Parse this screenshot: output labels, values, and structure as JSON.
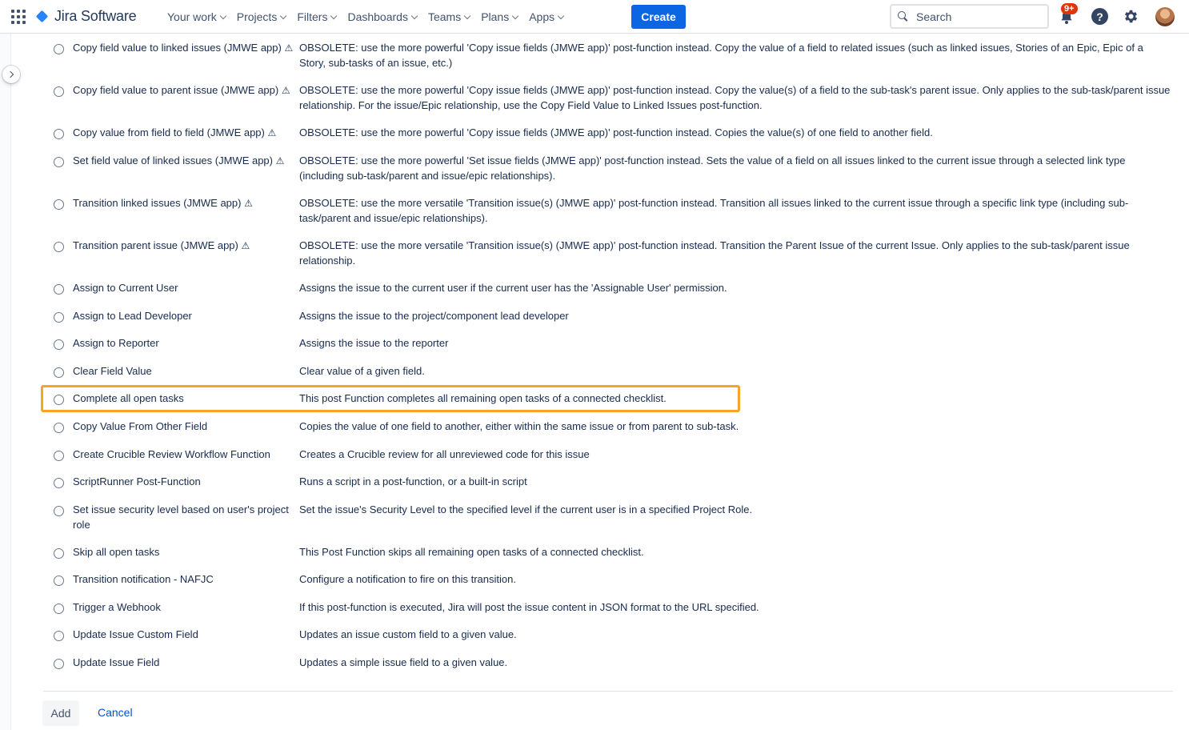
{
  "header": {
    "app_name": "Jira Software",
    "nav": [
      "Your work",
      "Projects",
      "Filters",
      "Dashboards",
      "Teams",
      "Plans",
      "Apps"
    ],
    "create_label": "Create",
    "search_placeholder": "Search",
    "notification_count": "9+",
    "help_label": "?"
  },
  "functions": [
    {
      "name": "Copy field value to linked issues (JMWE app)",
      "warning": true,
      "description": "OBSOLETE: use the more powerful 'Copy issue fields (JMWE app)' post-function instead. Copy the value of a field to related issues (such as linked issues, Stories of an Epic, Epic of a Story, sub-tasks of an issue, etc.)"
    },
    {
      "name": "Copy field value to parent issue (JMWE app)",
      "warning": true,
      "description": "OBSOLETE: use the more powerful 'Copy issue fields (JMWE app)' post-function instead. Copy the value(s) of a field to the sub-task's parent issue. Only applies to the sub-task/parent issue relationship. For the issue/Epic relationship, use the Copy Field Value to Linked Issues post-function."
    },
    {
      "name": "Copy value from field to field (JMWE app)",
      "warning": true,
      "description": "OBSOLETE: use the more powerful 'Copy issue fields (JMWE app)' post-function instead. Copies the value(s) of one field to another field."
    },
    {
      "name": "Set field value of linked issues (JMWE app)",
      "warning": true,
      "description": "OBSOLETE: use the more powerful 'Set issue fields (JMWE app)' post-function instead. Sets the value of a field on all issues linked to the current issue through a selected link type (including sub-task/parent and issue/epic relationships)."
    },
    {
      "name": "Transition linked issues (JMWE app)",
      "warning": true,
      "description": "OBSOLETE: use the more versatile 'Transition issue(s) (JMWE app)' post-function instead. Transition all issues linked to the current issue through a specific link type (including sub-task/parent and issue/epic relationships)."
    },
    {
      "name": "Transition parent issue (JMWE app)",
      "warning": true,
      "description": "OBSOLETE: use the more versatile 'Transition issue(s) (JMWE app)' post-function instead. Transition the Parent Issue of the current Issue. Only applies to the sub-task/parent issue relationship."
    },
    {
      "name": "Assign to Current User",
      "warning": false,
      "description": "Assigns the issue to the current user if the current user has the 'Assignable User' permission."
    },
    {
      "name": "Assign to Lead Developer",
      "warning": false,
      "description": "Assigns the issue to the project/component lead developer"
    },
    {
      "name": "Assign to Reporter",
      "warning": false,
      "description": "Assigns the issue to the reporter"
    },
    {
      "name": "Clear Field Value",
      "warning": false,
      "description": "Clear value of a given field."
    },
    {
      "name": "Complete all open tasks",
      "warning": false,
      "highlighted": true,
      "description": "This post Function completes all remaining open tasks of a connected checklist."
    },
    {
      "name": "Copy Value From Other Field",
      "warning": false,
      "description": "Copies the value of one field to another, either within the same issue or from parent to sub-task."
    },
    {
      "name": "Create Crucible Review Workflow Function",
      "warning": false,
      "description": "Creates a Crucible review for all unreviewed code for this issue"
    },
    {
      "name": "ScriptRunner Post-Function",
      "warning": false,
      "description": "Runs a script in a post-function, or a built-in script"
    },
    {
      "name": "Set issue security level based on user's project role",
      "warning": false,
      "description": "Set the issue's Security Level to the specified level if the current user is in a specified Project Role."
    },
    {
      "name": "Skip all open tasks",
      "warning": false,
      "description": "This Post Function skips all remaining open tasks of a connected checklist."
    },
    {
      "name": "Transition notification - NAFJC",
      "warning": false,
      "description": "Configure a notification to fire on this transition."
    },
    {
      "name": "Trigger a Webhook",
      "warning": false,
      "description": "If this post-function is executed, Jira will post the issue content in JSON format to the URL specified."
    },
    {
      "name": "Update Issue Custom Field",
      "warning": false,
      "description": "Updates an issue custom field to a given value."
    },
    {
      "name": "Update Issue Field",
      "warning": false,
      "description": "Updates a simple issue field to a given value."
    }
  ],
  "warning_symbol": "⚠",
  "footer": {
    "add_label": "Add",
    "cancel_label": "Cancel"
  },
  "colors": {
    "accent": "#0c66e4",
    "highlight_border": "#f6a623",
    "badge": "#de350b"
  }
}
